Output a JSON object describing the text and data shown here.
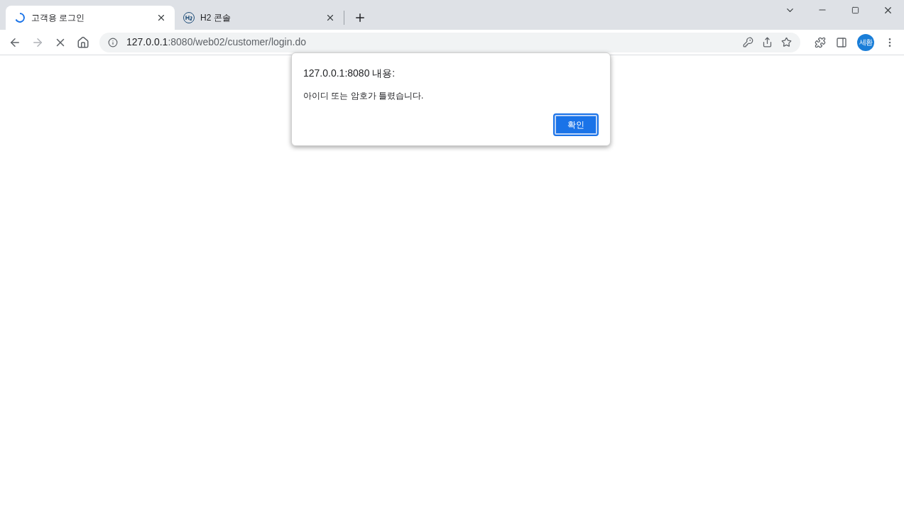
{
  "tabs": [
    {
      "title": "고객용 로그인",
      "selected": true,
      "kind": "loading"
    },
    {
      "title": "H2 콘솔",
      "selected": false,
      "kind": "h2"
    }
  ],
  "address_bar": {
    "host": "127.0.0.1",
    "path": ":8080/web02/customer/login.do"
  },
  "profile": {
    "initials": "세환"
  },
  "dialog": {
    "title": "127.0.0.1:8080 내용:",
    "message": "아이디 또는 암호가 틀렸습니다.",
    "button": "확인"
  }
}
